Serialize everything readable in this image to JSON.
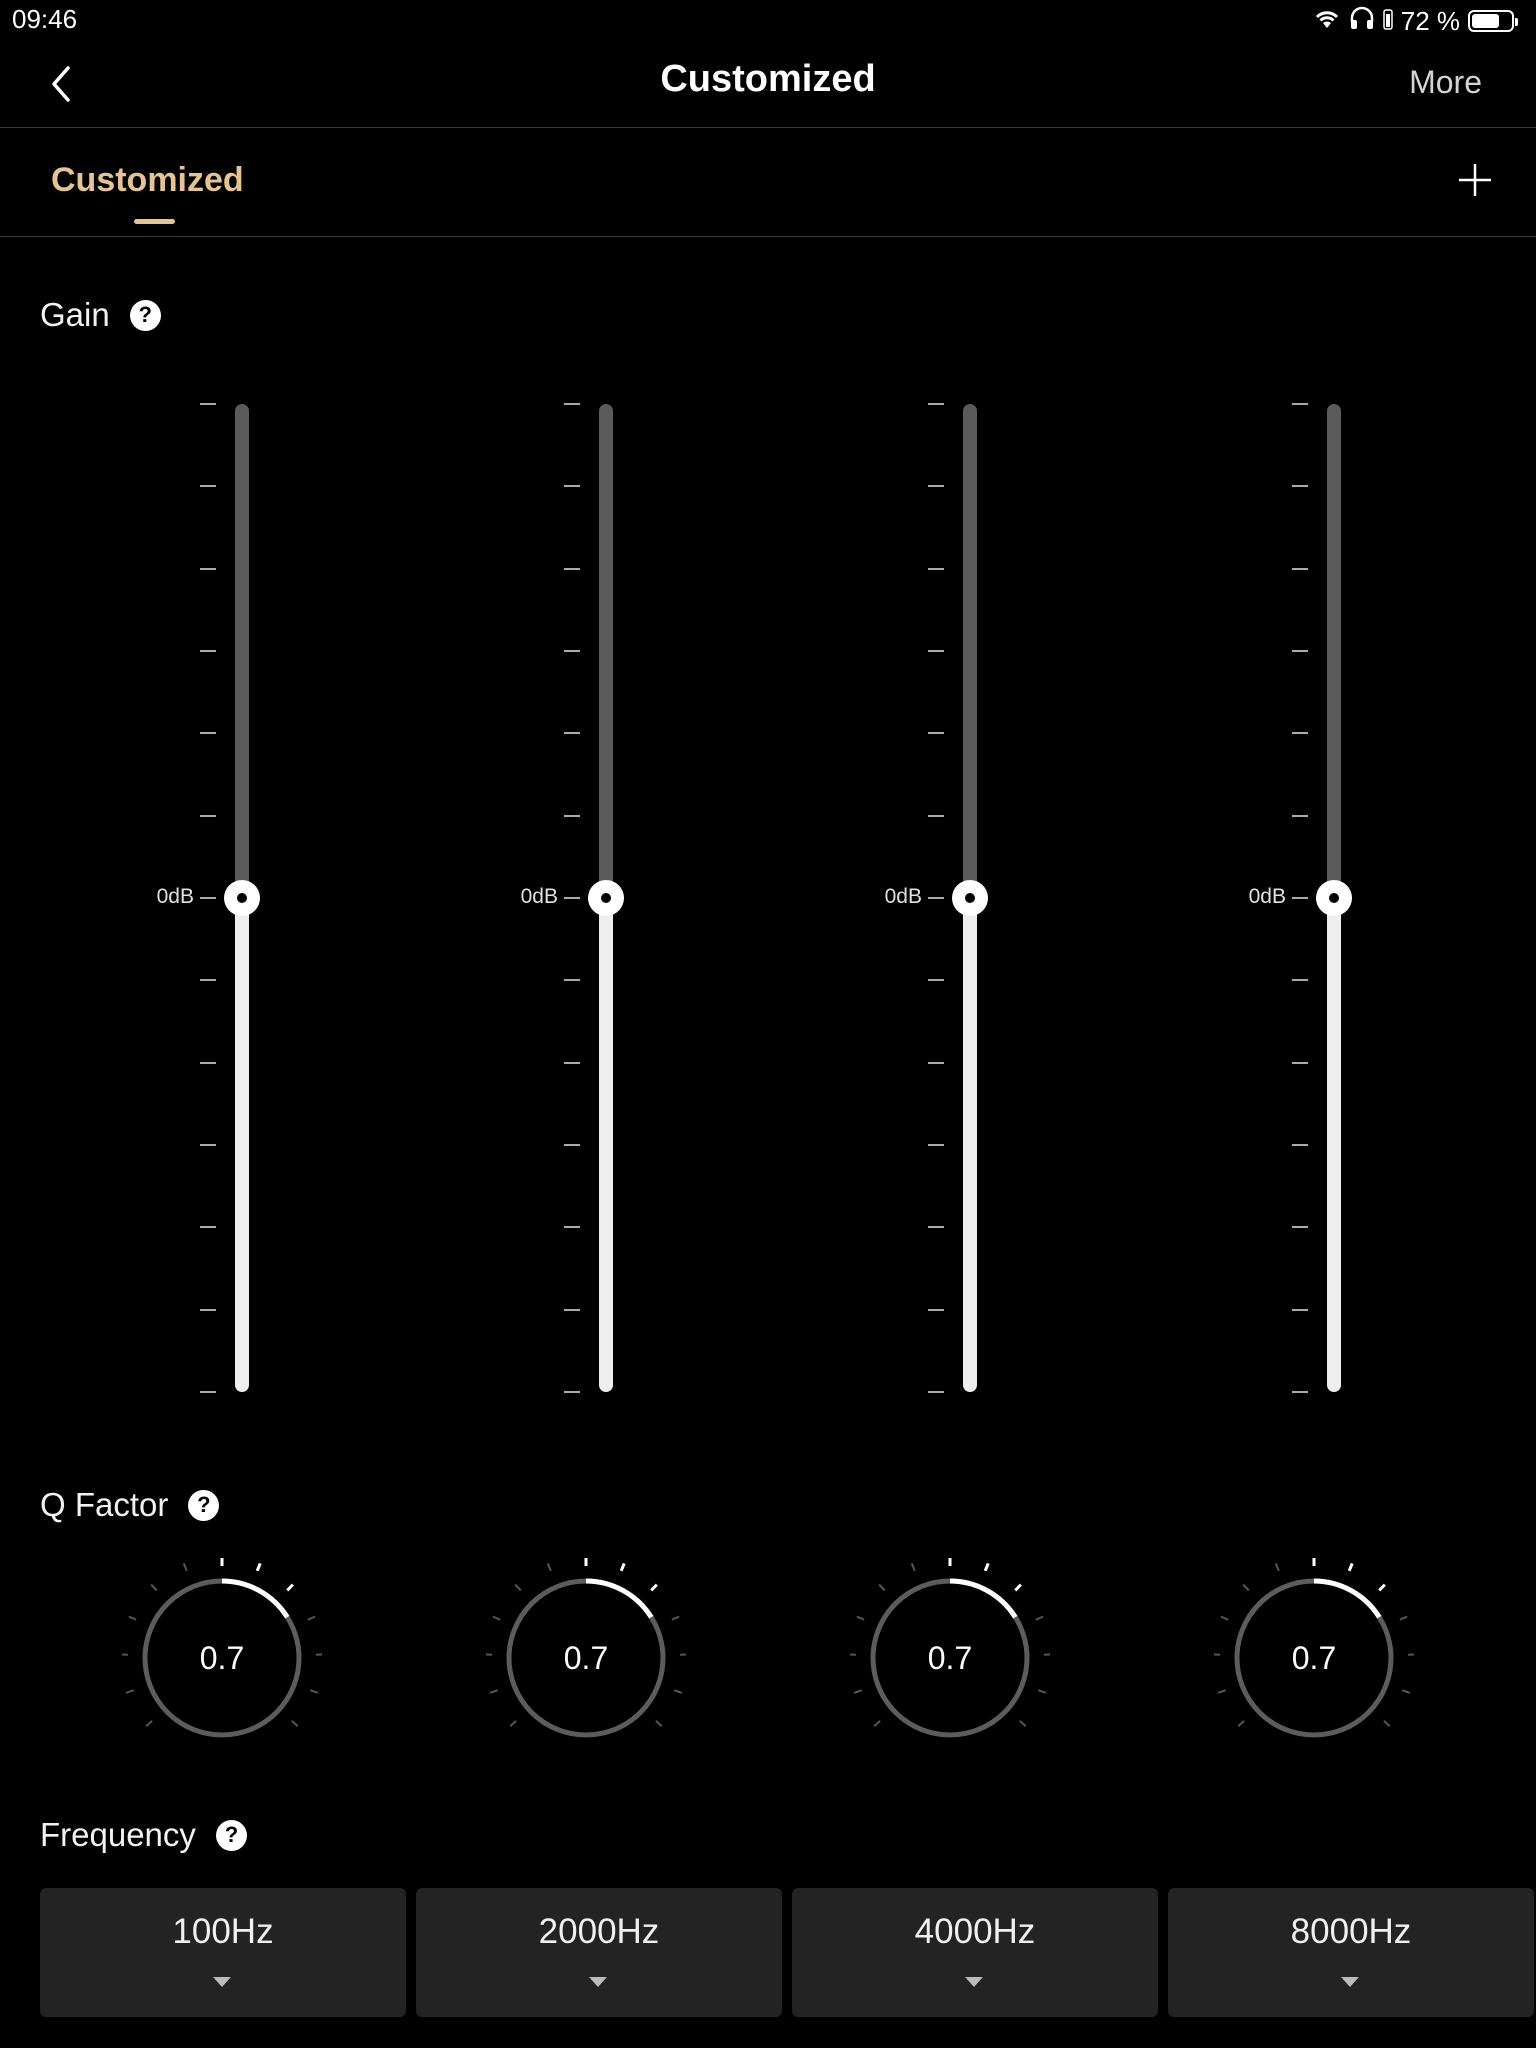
{
  "status": {
    "time": "09:46",
    "battery_text": "72 %",
    "battery_level": 0.72
  },
  "nav": {
    "title": "Customized",
    "more_label": "More"
  },
  "tabs": [
    {
      "label": "Customized",
      "active": true
    }
  ],
  "sections": {
    "gain": "Gain",
    "q_factor": "Q Factor",
    "frequency": "Frequency"
  },
  "help_glyph": "?",
  "colors": {
    "accent": "#e5c48f",
    "background": "#000000",
    "track_inactive": "#5a5a5a",
    "track_active": "#eeeeee",
    "button_bg": "#232323"
  },
  "bands": [
    {
      "gain_label": "0dB",
      "gain_db": 0,
      "q": "0.7",
      "frequency": "100Hz"
    },
    {
      "gain_label": "0dB",
      "gain_db": 0,
      "q": "0.7",
      "frequency": "2000Hz"
    },
    {
      "gain_label": "0dB",
      "gain_db": 0,
      "q": "0.7",
      "frequency": "4000Hz"
    },
    {
      "gain_label": "0dB",
      "gain_db": 0,
      "q": "0.7",
      "frequency": "8000Hz"
    }
  ]
}
